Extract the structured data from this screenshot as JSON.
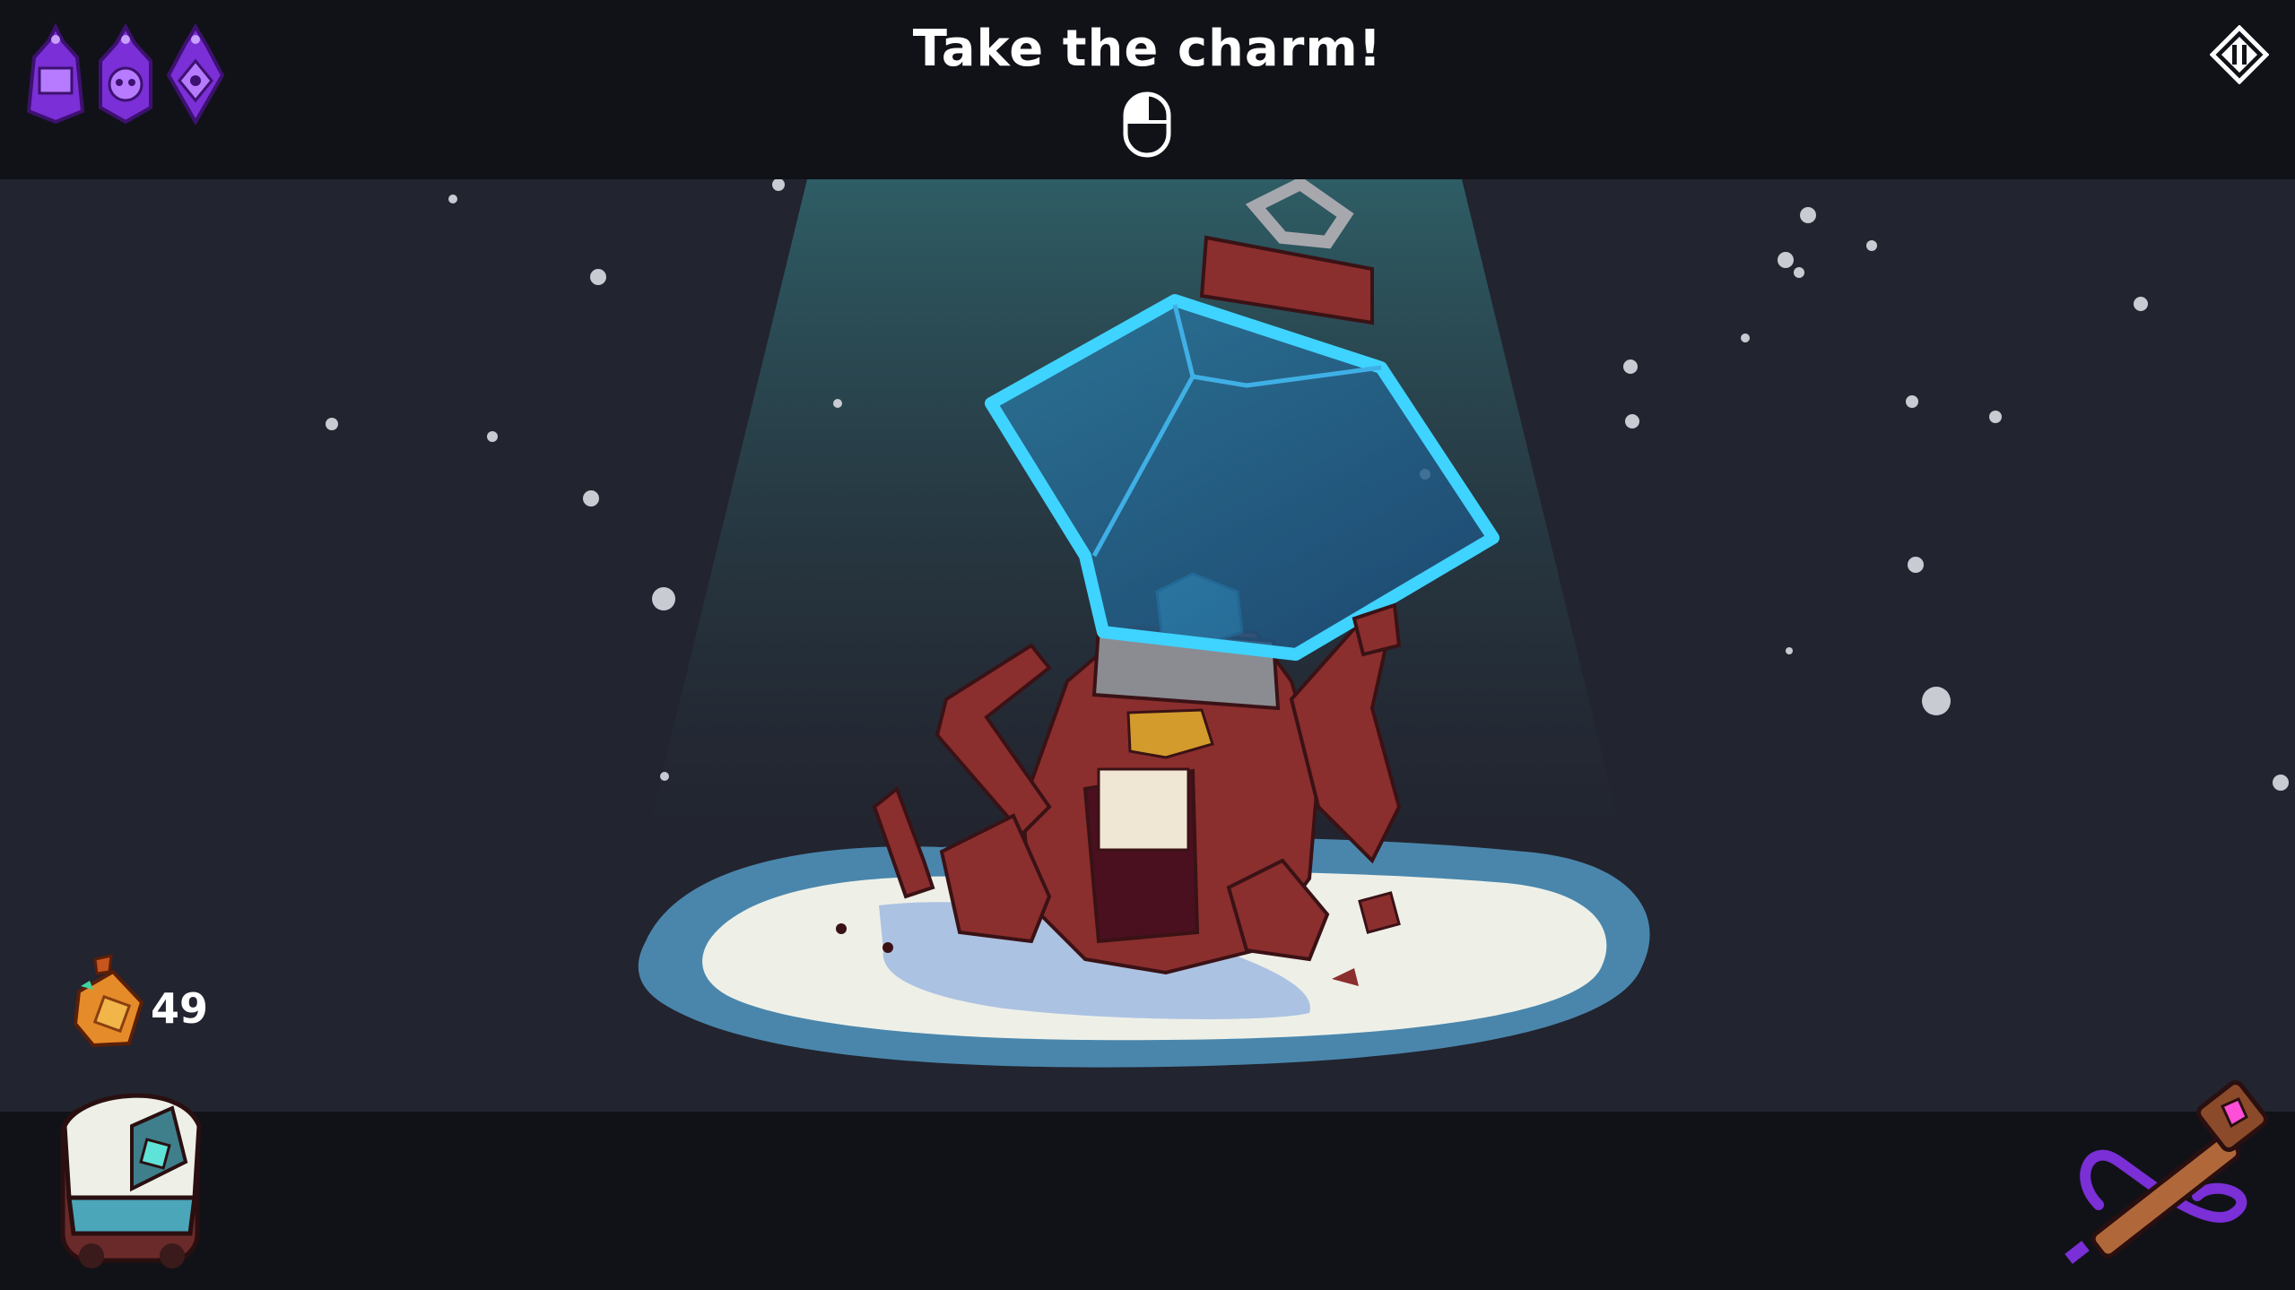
{
  "hud": {
    "prompt": "Take the charm!",
    "input_hint_icon": "mouse-left-click-icon",
    "pause_icon": "pause-icon",
    "charm_slots": [
      {
        "icon": "purple-charm-icon"
      },
      {
        "icon": "purple-skull-charm-icon"
      },
      {
        "icon": "purple-eye-charm-icon"
      }
    ],
    "currency": {
      "icon": "coin-pouch-icon",
      "value": "49"
    },
    "backpack_icon": "backpack-icon",
    "wand_icon": "magic-wand-icon"
  },
  "scene": {
    "subject": "stone-golem-holding-ice-jar",
    "colors": {
      "background": "#22242f",
      "bars": "#111218",
      "spotlight": "#2e5a63",
      "golem": "#8b2e2e",
      "ice": "#3fb8e0",
      "snow": "#eef0e8",
      "charm_purple": "#7b2fd6"
    }
  }
}
